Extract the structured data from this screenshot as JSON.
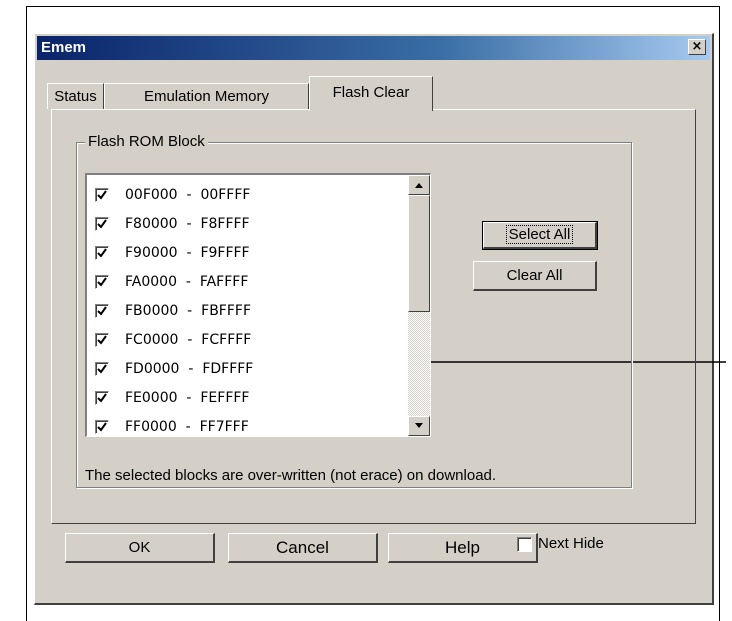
{
  "document": {
    "caption": "Dialog"
  },
  "window": {
    "title": "Emem",
    "close_glyph": "×"
  },
  "tabs": [
    {
      "label": "Status",
      "active": false
    },
    {
      "label": "Emulation Memory",
      "active": false
    },
    {
      "label": "Flash Clear",
      "active": true
    }
  ],
  "group": {
    "label": "Flash ROM Block"
  },
  "blocks": [
    {
      "range": "00F000  -  00FFFF",
      "checked": true
    },
    {
      "range": "F80000  -  F8FFFF",
      "checked": true
    },
    {
      "range": "F90000  -  F9FFFF",
      "checked": true
    },
    {
      "range": "FA0000  -  FAFFFF",
      "checked": true
    },
    {
      "range": "FB0000  -  FBFFFF",
      "checked": true
    },
    {
      "range": "FC0000  -  FCFFFF",
      "checked": true
    },
    {
      "range": "FD0000  -  FDFFFF",
      "checked": true
    },
    {
      "range": "FE0000  -  FEFFFF",
      "checked": true
    },
    {
      "range": "FF0000  -  FF7FFF",
      "checked": true
    }
  ],
  "buttons": {
    "select_all": "Select All",
    "clear_all": "Clear All",
    "ok": "OK",
    "cancel": "Cancel",
    "help": "Help"
  },
  "note": "The selected blocks are over-written (not erace) on download.",
  "next_hide": {
    "label": "Next Hide",
    "checked": false
  },
  "colors": {
    "title_start": "#0a246a",
    "title_end": "#a6caf0",
    "face": "#d4d0c8"
  }
}
